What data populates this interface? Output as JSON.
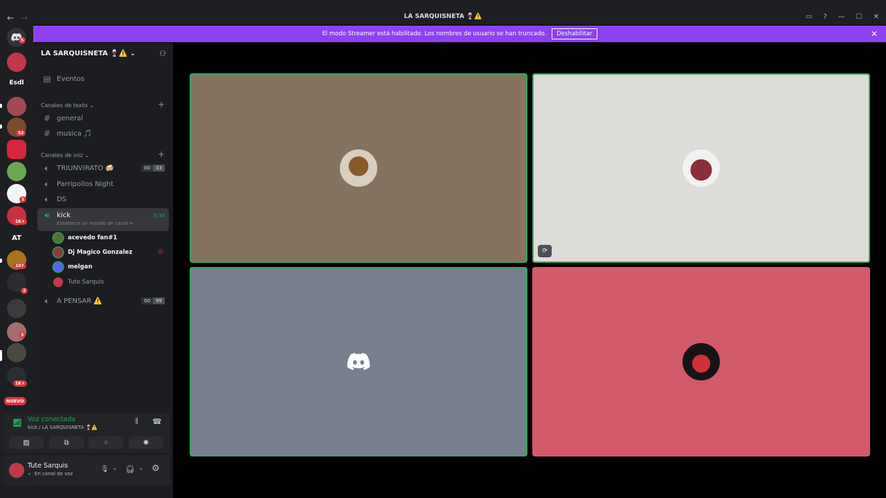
{
  "window": {
    "title": "LA SARQUISNETA 🍷⚠️",
    "nav_back": "←",
    "nav_forward": "→"
  },
  "banner": {
    "text": "El modo Streamer está habilitado. Los nombres de usuario se han truncado.",
    "button": "Deshabilitar"
  },
  "rail": {
    "home_badge": "5",
    "servers": [
      {
        "label": "",
        "badge": ""
      },
      {
        "label": "Esdl",
        "badge": ""
      },
      {
        "label": "",
        "badge": ""
      },
      {
        "label": "",
        "badge": "52"
      },
      {
        "label": "",
        "badge": ""
      },
      {
        "label": "",
        "badge": ""
      },
      {
        "label": "",
        "badge": "1"
      },
      {
        "label": "",
        "badge": "1K+"
      },
      {
        "label": "AT",
        "badge": ""
      },
      {
        "label": "",
        "badge": "107"
      },
      {
        "label": "",
        "badge": "2"
      },
      {
        "label": "",
        "badge": ""
      },
      {
        "label": "",
        "badge": "3"
      },
      {
        "label": "",
        "badge": ""
      },
      {
        "label": "",
        "badge": "1K+"
      }
    ],
    "nuevo": "NUEVO"
  },
  "sidebar": {
    "server_name": "LA SARQUISNETA 🍷⚠️",
    "events": "Eventos",
    "text_category": "Canales de texto",
    "text_channels": [
      "general",
      "musica 🎵"
    ],
    "voice_category": "Canales de voz",
    "voice_channels": [
      {
        "name": "TRIUNVIRATO 🍻",
        "pill_a": "00",
        "pill_b": "03"
      },
      {
        "name": "Parripollos Night"
      },
      {
        "name": "DS"
      }
    ],
    "active_channel": {
      "name": "kick",
      "time": "5:39",
      "status": "Establece un estado de canal ✏"
    },
    "users": [
      "acevedo fan#1",
      "Dj Magico Gonzalez",
      "melgan",
      "Tute Sarquis"
    ],
    "last_channel": {
      "name": "A PENSAR ⚠️",
      "pill_a": "00",
      "pill_b": "99"
    }
  },
  "voice": {
    "status": "Voz conectada",
    "location": "kick / LA SARQUISNETA 🍷⚠️"
  },
  "user": {
    "name": "Tute Sarquis",
    "status": "En canal de voz"
  },
  "colors": {
    "accent": "#8d41f2",
    "speaking": "#3ba55d",
    "tile1": "#857360",
    "tile2": "#dddcd8",
    "tile3": "#777f8e",
    "tile4": "#d35a69"
  }
}
